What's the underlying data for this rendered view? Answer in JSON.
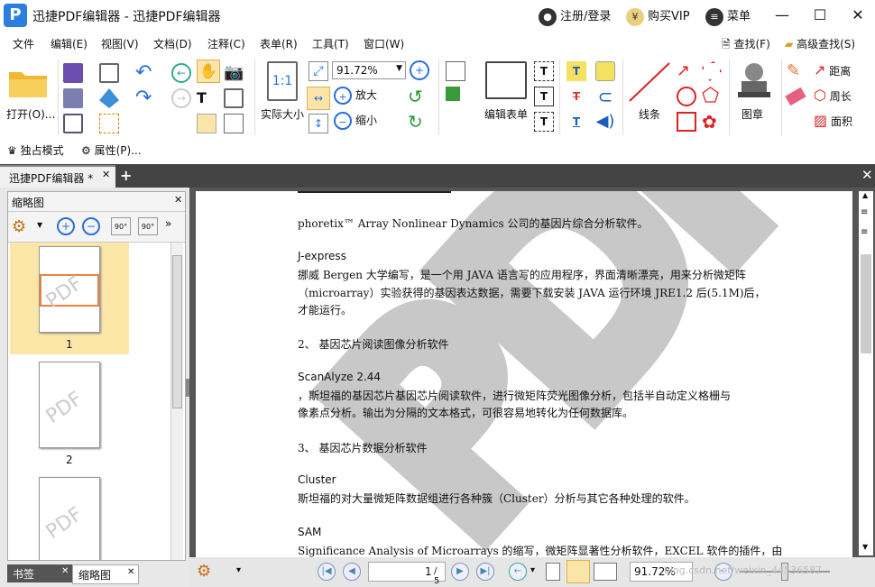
{
  "window": {
    "app_title": "迅捷PDF编辑器 - 迅捷PDF编辑器",
    "login": "注册/登录",
    "vip": "购买VIP",
    "vip_symbol": "¥",
    "menu": "菜单"
  },
  "menubar": [
    "文件",
    "编辑(E)",
    "视图(V)",
    "文档(D)",
    "注释(C)",
    "表单(R)",
    "工具(T)",
    "窗口(W)"
  ],
  "menubar_right": {
    "find": "查找(F)",
    "adv_find": "高级查找(S)"
  },
  "ribbon": {
    "open": "打开(O)...",
    "actual_size": "实际大小",
    "actual_size_icon": "1:1",
    "zoom_value": "91.72%",
    "zoom_in": "放大",
    "zoom_out": "缩小",
    "edit_form": "编辑表单",
    "line": "线条",
    "stamp": "图章",
    "distance": "距离",
    "perimeter": "周长",
    "area": "面积"
  },
  "quickbar": {
    "exclusive": "独占模式",
    "properties": "属性(P)..."
  },
  "tabs": {
    "doc_tab": "迅捷PDF编辑器 *",
    "add": "+"
  },
  "thumbpanel": {
    "title": "缩略图",
    "pages": [
      "1",
      "2"
    ],
    "rotate": "90°",
    "watermark": "PDF"
  },
  "bottom_tabs": {
    "bookmarks": "书签",
    "thumbs": "缩略图"
  },
  "doc": {
    "watermark": "PDF",
    "lines": [
      "phoretix™ Array Nonlinear Dynamics 公司的基因片综合分析软件。",
      "J-express",
      "挪威 Bergen 大学编写，是一个用 JAVA 语言写的应用程序，界面清晰漂亮，用来分析微矩阵",
      "（microarray）实验获得的基因表达数据，需要下载安装 JAVA 运行环境 JRE1.2 后(5.1M)后，",
      "才能运行。",
      "2、  基因芯片阅读图像分析软件",
      "ScanAlyze 2.44",
      "，斯坦福的基因芯片基因芯片阅读软件，进行微矩阵荧光图像分析，包括半自动定义格栅与",
      "像素点分析。输出为分隔的文本格式，可很容易地转化为任何数据库。",
      "3、  基因芯片数据分析软件",
      "Cluster",
      "斯坦福的对大量微矩阵数据组进行各种簇（Cluster）分析与其它各种处理的软件。",
      "SAM",
      "Significance Analysis of Microarrays  的缩写，微矩阵显著性分析软件，EXCEL 软件的插件，由"
    ]
  },
  "status": {
    "page_input": "1",
    "page_total": "/ 5",
    "zoom": "91.72%",
    "blog": "blog.csdn.net/weixin_44536587"
  }
}
